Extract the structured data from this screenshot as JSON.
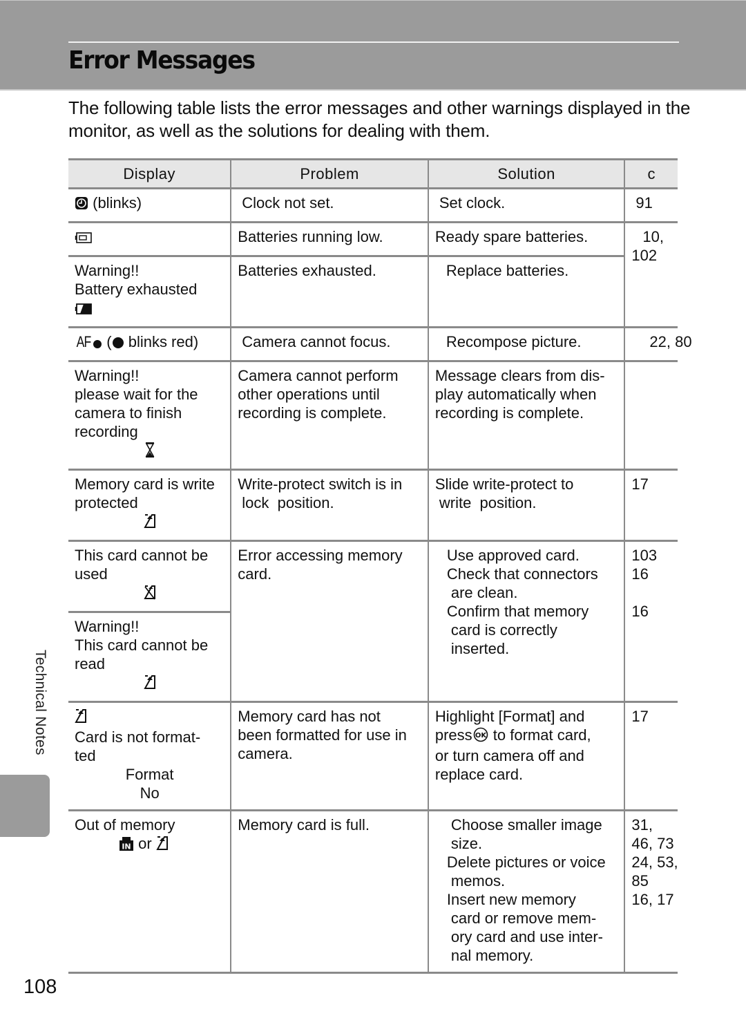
{
  "header": {
    "title": "Error Messages"
  },
  "intro": "The following table lists the error messages and other warnings displayed in the monitor, as well as the solutions for dealing with them.",
  "table": {
    "columns": [
      "Display",
      "Problem",
      "Solution",
      "c"
    ],
    "rows": [
      {
        "display": {
          "icon": "clock-icon",
          "text": "(blinks)"
        },
        "problem": [
          "Clock not set."
        ],
        "solution": [
          "Set clock."
        ],
        "ref": [
          "91"
        ]
      },
      {
        "display": {
          "icon": "battery-low-icon"
        },
        "problem": [
          "Batteries running low."
        ],
        "solution": [
          "Ready spare batteries."
        ],
        "ref": [
          "10,",
          "102"
        ]
      },
      {
        "display": {
          "lines": [
            "Warning!!",
            "Battery exhausted"
          ],
          "icon": "battery-exhausted-icon"
        },
        "problem": [
          "Batteries exhausted."
        ],
        "solution": [
          "Replace batteries."
        ]
      },
      {
        "display": {
          "af_label": "AF",
          "icon": "focus-indicator-icon",
          "text": "blinks red"
        },
        "problem": [
          "Camera cannot focus."
        ],
        "solution": [
          "Recompose picture."
        ],
        "ref": [
          "22, 80"
        ]
      },
      {
        "display": {
          "lines": [
            "Warning!!",
            "please wait for the",
            "camera to finish",
            "recording"
          ],
          "icon": "hourglass-icon"
        },
        "problem": [
          "Camera cannot perform",
          "other operations until",
          "recording is complete."
        ],
        "solution": [
          "Message clears from dis-",
          "play automatically when",
          "recording is complete."
        ],
        "ref": []
      },
      {
        "display": {
          "lines": [
            "Memory card is write",
            "protected"
          ],
          "icon": "memory-card-icon"
        },
        "problem": [
          "Write-protect switch is in",
          "lock  position."
        ],
        "solution": [
          "Slide write-protect to",
          "write  position."
        ],
        "ref": [
          "17"
        ]
      },
      {
        "display": {
          "lines": [
            "This card cannot be",
            "used"
          ],
          "icon": "memory-card-crossed-icon"
        },
        "problem": [
          "Error accessing memory",
          "card."
        ],
        "solution": [
          [
            "Use approved card."
          ],
          [
            "Check that connectors",
            "are clean."
          ],
          [
            "Confirm that memory",
            "card is correctly",
            "inserted."
          ]
        ],
        "ref": [
          "103",
          "16",
          "",
          "16"
        ]
      },
      {
        "display": {
          "lines": [
            "Warning!!",
            "This card cannot be",
            "read"
          ],
          "icon": "memory-card-icon"
        }
      },
      {
        "display": {
          "icon": "memory-card-icon",
          "lines": [
            "Card is not format-",
            "ted"
          ],
          "menu": [
            "Format",
            "No"
          ]
        },
        "problem": [
          "Memory card has not",
          "been formatted for use in",
          "camera."
        ],
        "solution": [
          "Highlight [Format] and",
          "press",
          "to format card,",
          "or turn camera off and",
          "replace card."
        ],
        "solution_button": "OK",
        "ref": [
          "17"
        ]
      },
      {
        "display": {
          "lines": [
            "Out of memory"
          ],
          "icon_a": "internal-memory-icon",
          "or": "or",
          "icon_b": "memory-card-icon"
        },
        "problem": [
          "Memory card is full."
        ],
        "solution": [
          [
            "Choose smaller image",
            "size."
          ],
          [
            "Delete pictures or voice",
            "memos."
          ],
          [
            "Insert new memory",
            "card or remove mem-",
            "ory card and use inter-",
            "nal memory."
          ]
        ],
        "ref": [
          "31,",
          "46, 73",
          "24, 53,",
          "85",
          "16, 17"
        ]
      }
    ]
  },
  "sidebar": {
    "section_label": "Technical Notes"
  },
  "footer": {
    "page_number": "108"
  },
  "colors": {
    "header_band": "#9b9b9b",
    "table_rule": "#8a8a8a",
    "table_header_bg": "#e6e6e6"
  }
}
